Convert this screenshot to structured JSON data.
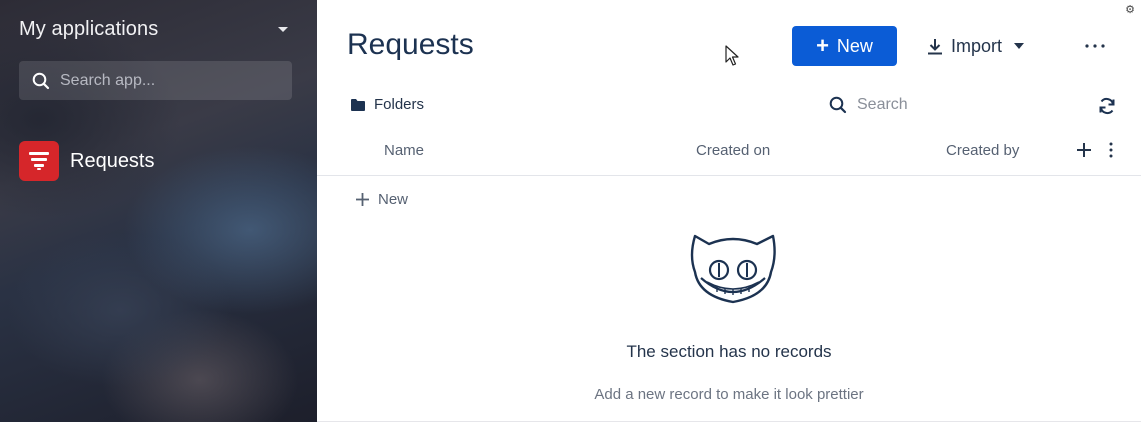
{
  "sidebar": {
    "title": "My applications",
    "search_placeholder": "Search app...",
    "apps": [
      {
        "label": "Requests",
        "icon": "requests-app-icon",
        "color": "#d6262a"
      }
    ]
  },
  "main": {
    "title": "Requests",
    "new_button": "New",
    "import_button": "Import",
    "folders_label": "Folders",
    "search_placeholder": "Search",
    "columns": [
      "Name",
      "Created on",
      "Created by"
    ],
    "add_new_label": "New",
    "empty_title": "The section has no records",
    "empty_subtitle": "Add a new record to make it look prettier"
  },
  "colors": {
    "accent": "#0b5cd6",
    "brand_red": "#d6262a",
    "text_dark": "#1c3251"
  }
}
